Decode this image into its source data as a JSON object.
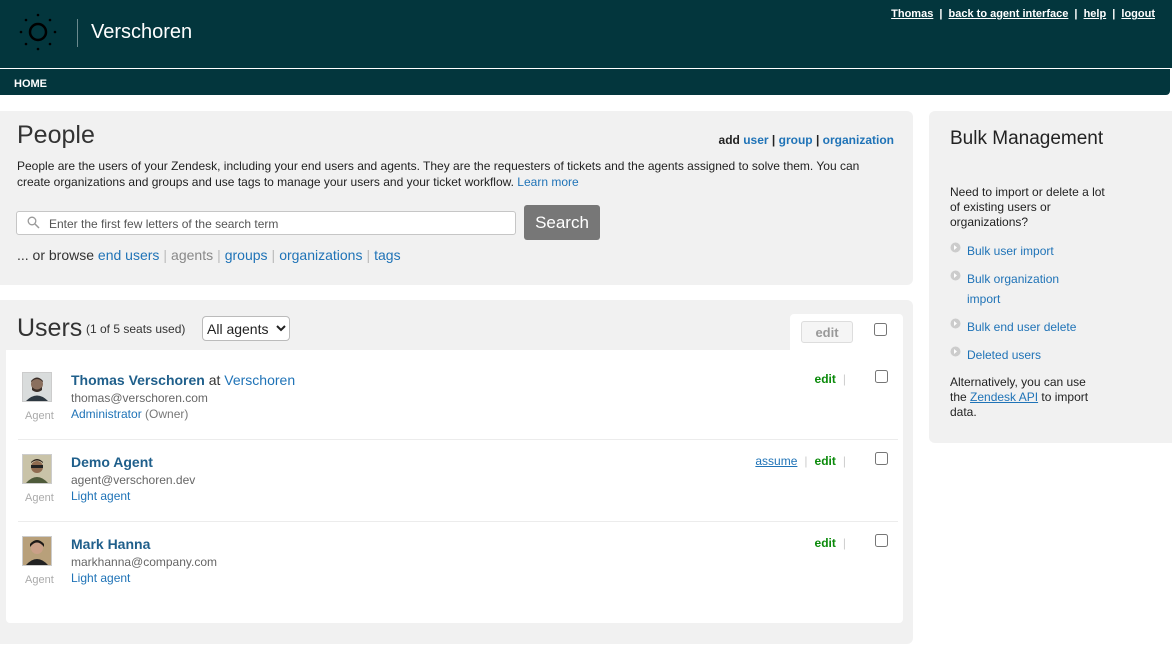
{
  "header": {
    "brand": "Verschoren",
    "toplinks": {
      "user": "Thomas",
      "agent_interface": "back to agent interface",
      "help": "help",
      "logout": "logout",
      "separator": "|"
    }
  },
  "nav": {
    "home": "HOME"
  },
  "people": {
    "title": "People",
    "add_label": "add",
    "add_user": "user",
    "add_group": "group",
    "add_org": "organization",
    "separator": "|",
    "description": "People are the users of your Zendesk, including your end users and agents. They are the requesters of tickets and the agents assigned to solve them. You can create organizations and groups and use tags to manage your users and your ticket workflow.",
    "learn_more": "Learn more",
    "search_placeholder": "Enter the first few letters of the search term",
    "search_button": "Search",
    "browse_prefix": "... or browse",
    "browse_end_users": "end users",
    "browse_agents": "agents",
    "browse_groups": "groups",
    "browse_orgs": "organizations",
    "browse_tags": "tags"
  },
  "users": {
    "title": "Users",
    "seats": "(1 of 5 seats used)",
    "filter_selected": "All agents",
    "edit_button": "edit",
    "list": [
      {
        "name": "Thomas Verschoren",
        "at": "at",
        "org": "Verschoren",
        "email": "thomas@verschoren.com",
        "role": "Administrator",
        "owner": "(Owner)",
        "tag": "Agent",
        "assume": "",
        "edit": "edit"
      },
      {
        "name": "Demo Agent",
        "at": "",
        "org": "",
        "email": "agent@verschoren.dev",
        "role": "Light agent",
        "owner": "",
        "tag": "Agent",
        "assume": "assume",
        "edit": "edit"
      },
      {
        "name": "Mark Hanna",
        "at": "",
        "org": "",
        "email": "markhanna@company.com",
        "role": "Light agent",
        "owner": "",
        "tag": "Agent",
        "assume": "",
        "edit": "edit"
      }
    ]
  },
  "bulk": {
    "title": "Bulk Management",
    "description": "Need to import or delete a lot of existing users or organizations?",
    "items": [
      "Bulk user import",
      "Bulk organization import",
      "Bulk end user delete",
      "Deleted users"
    ],
    "alt_prefix": "Alternatively, you can use the",
    "api_link": "Zendesk API",
    "alt_suffix": "to import data."
  },
  "colors": {
    "header_bg": "#03363d",
    "link": "#1f73b7",
    "edit_green": "#0a8a0a",
    "panel_bg": "#f1f1f1"
  }
}
